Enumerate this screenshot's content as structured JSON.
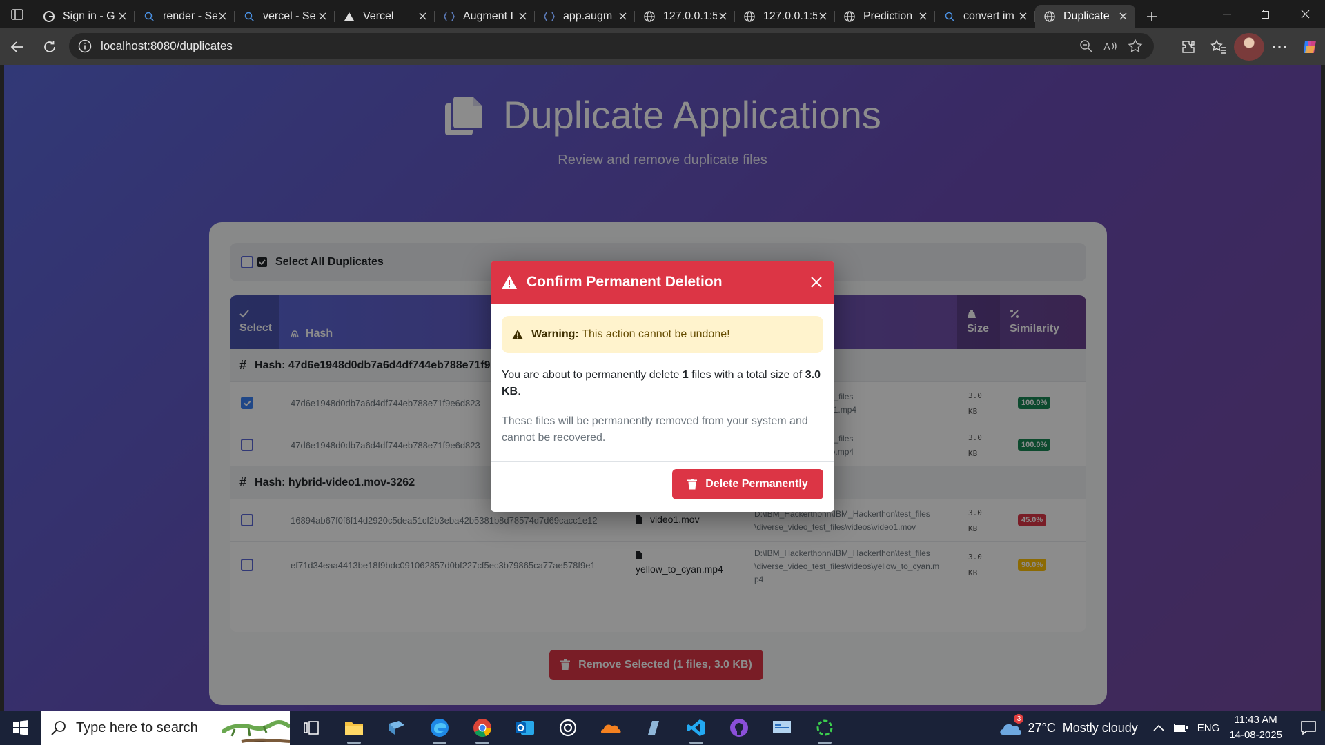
{
  "browser": {
    "tabs": [
      {
        "title": "Sign in - G",
        "icon": "google-icon"
      },
      {
        "title": "render - Se",
        "icon": "search-icon"
      },
      {
        "title": "vercel - Se",
        "icon": "search-icon"
      },
      {
        "title": "Vercel",
        "icon": "vercel-icon"
      },
      {
        "title": "Augment I",
        "icon": "augment-icon"
      },
      {
        "title": "app.augm",
        "icon": "augment-icon"
      },
      {
        "title": "127.0.0.1:5",
        "icon": "globe-icon"
      },
      {
        "title": "127.0.0.1:5",
        "icon": "globe-icon"
      },
      {
        "title": "Prediction",
        "icon": "globe-icon"
      },
      {
        "title": "convert im",
        "icon": "search-icon"
      },
      {
        "title": "Duplicate",
        "icon": "globe-icon",
        "active": true
      }
    ],
    "url": "localhost:8080/duplicates"
  },
  "page": {
    "title": "Duplicate Applications",
    "subtitle": "Review and remove duplicate files"
  },
  "select_all": {
    "label": "Select All Duplicates"
  },
  "table": {
    "columns": {
      "select": "Select",
      "hash": "Hash",
      "size": "Size",
      "similarity": "Similarity"
    },
    "groups": [
      {
        "label": "Hash: 47d6e1948d0db7a6d4df744eb788e71f9e",
        "rows": [
          {
            "checked": true,
            "hash": "47d6e1948d0db7a6d4df744eb788e71f9e6d823",
            "filename": "",
            "path_line1": "\\IBM_Hackerthon\\test_files",
            "path_line2": "files\\videos\\movie_001.mp4",
            "path_line3": "",
            "size_num": "3.0",
            "size_unit": "KB",
            "similarity": "100.0%",
            "sim_color": "#198754"
          },
          {
            "checked": false,
            "hash": "47d6e1948d0db7a6d4df744eb788e71f9e6d823",
            "filename": "",
            "path_line1": "\\IBM_Hackerthon\\test_files",
            "path_line2": "files\\videos\\my_movie.mp4",
            "path_line3": "",
            "size_num": "3.0",
            "size_unit": "KB",
            "similarity": "100.0%",
            "sim_color": "#198754"
          }
        ]
      },
      {
        "label": "Hash: hybrid-video1.mov-3262",
        "rows": [
          {
            "checked": false,
            "hash": "16894ab67f0f6f14d2920c5dea51cf2b3eba42b5381b8d78574d7d69cacc1e12",
            "filename": "video1.mov",
            "path_line1": "D:\\IBM_Hackerthonn\\IBM_Hackerthon\\test_files",
            "path_line2": "\\diverse_video_test_files\\videos\\video1.mov",
            "path_line3": "",
            "size_num": "3.0",
            "size_unit": "KB",
            "similarity": "45.0%",
            "sim_color": "#dc3545"
          },
          {
            "checked": false,
            "hash": "ef71d34eaa4413be18f9bdc091062857d0bf227cf5ec3b79865ca77ae578f9e1",
            "filename": "yellow_to_cyan.mp4",
            "path_line1": "D:\\IBM_Hackerthonn\\IBM_Hackerthon\\test_files",
            "path_line2": "\\diverse_video_test_files\\videos\\yellow_to_cyan.m",
            "path_line3": "p4",
            "size_num": "3.0",
            "size_unit": "KB",
            "similarity": "90.0%",
            "sim_color": "#ffc107"
          }
        ]
      }
    ]
  },
  "remove_button": {
    "label": "Remove Selected (1 files, 3.0 KB)"
  },
  "modal": {
    "title": "Confirm Permanent Deletion",
    "warning_bold": "Warning:",
    "warning_text": "This action cannot be undone!",
    "msg_prefix": "You are about to permanently delete",
    "count": "1",
    "msg_mid": "files with a total size of",
    "size": "3.0 KB",
    "msg_end": ".",
    "msg2": "These files will be permanently removed from your system and cannot be recovered.",
    "delete_label": "Delete Permanently"
  },
  "taskbar": {
    "search_placeholder": "Type here to search",
    "weather": "27°C  Mostly cloudy",
    "weather_badge": "3",
    "lang": "ENG",
    "time": "11:43 AM",
    "date": "14-08-2025"
  },
  "colors": {
    "danger": "#dc3545",
    "primary": "#5a67d8",
    "purple": "#764ba2"
  }
}
